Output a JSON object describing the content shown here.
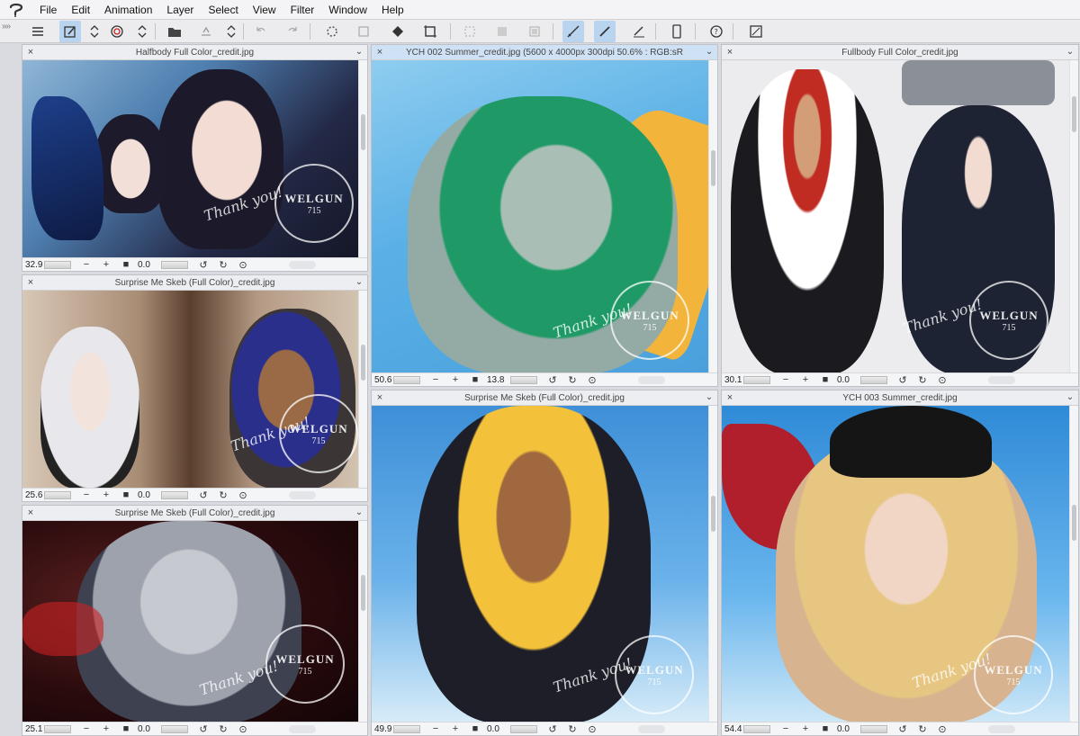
{
  "menu": {
    "items": [
      "File",
      "Edit",
      "Animation",
      "Layer",
      "Select",
      "View",
      "Filter",
      "Window",
      "Help"
    ]
  },
  "toolbar": {
    "icons": [
      "menu-icon",
      "edit-icon",
      "stepper-icon",
      "spiral-icon",
      "stepper-icon",
      "open-folder-icon",
      "save-icon",
      "stepper-icon",
      "undo-icon",
      "redo-icon",
      "loading-icon",
      "transform-icon",
      "fill-icon",
      "crop-icon",
      "select-icon",
      "deselect-icon",
      "invert-icon",
      "ruler-icon",
      "brush-icon",
      "pen-icon",
      "phone-icon",
      "help-icon",
      "fullscreen-icon"
    ]
  },
  "panes": [
    {
      "title": "Halfbody Full Color_credit.jpg",
      "zoom": "32.9",
      "angle": "0.0",
      "watermark": "WELGUN",
      "watermark_num": "715",
      "thanks": "Thank you!"
    },
    {
      "title": "Surprise Me Skeb (Full Color)_credit.jpg",
      "zoom": "25.6",
      "angle": "0.0",
      "watermark": "WELGUN",
      "watermark_num": "715",
      "thanks": "Thank you!"
    },
    {
      "title": "Surprise Me Skeb (Full Color)_credit.jpg",
      "zoom": "25.1",
      "angle": "0.0",
      "watermark": "WELGUN",
      "watermark_num": "715",
      "thanks": "Thank you!"
    },
    {
      "title": "YCH 002 Summer_credit.jpg (5600 x 4000px 300dpi 50.6% : RGB:sR",
      "zoom": "50.6",
      "angle": "13.8",
      "watermark": "WELGUN",
      "watermark_num": "715",
      "thanks": "Thank you!"
    },
    {
      "title": "Surprise Me Skeb (Full Color)_credit.jpg",
      "zoom": "49.9",
      "angle": "0.0",
      "watermark": "WELGUN",
      "watermark_num": "715",
      "thanks": "Thank you!"
    },
    {
      "title": "Fullbody Full Color_credit.jpg",
      "zoom": "30.1",
      "angle": "0.0",
      "watermark": "WELGUN",
      "watermark_num": "715",
      "thanks": "Thank you!"
    },
    {
      "title": "YCH 003 Summer_credit.jpg",
      "zoom": "54.4",
      "angle": "0.0",
      "watermark": "WELGUN",
      "watermark_num": "715",
      "thanks": "Thank you!"
    }
  ],
  "status_buttons": {
    "minus": "−",
    "plus": "+",
    "square": "■",
    "rotate_left": "↺",
    "rotate_right": "↻",
    "reset": "⊙"
  },
  "colors": {
    "active_tab": "#cfe1f4",
    "accent": "#2f7fd0"
  }
}
